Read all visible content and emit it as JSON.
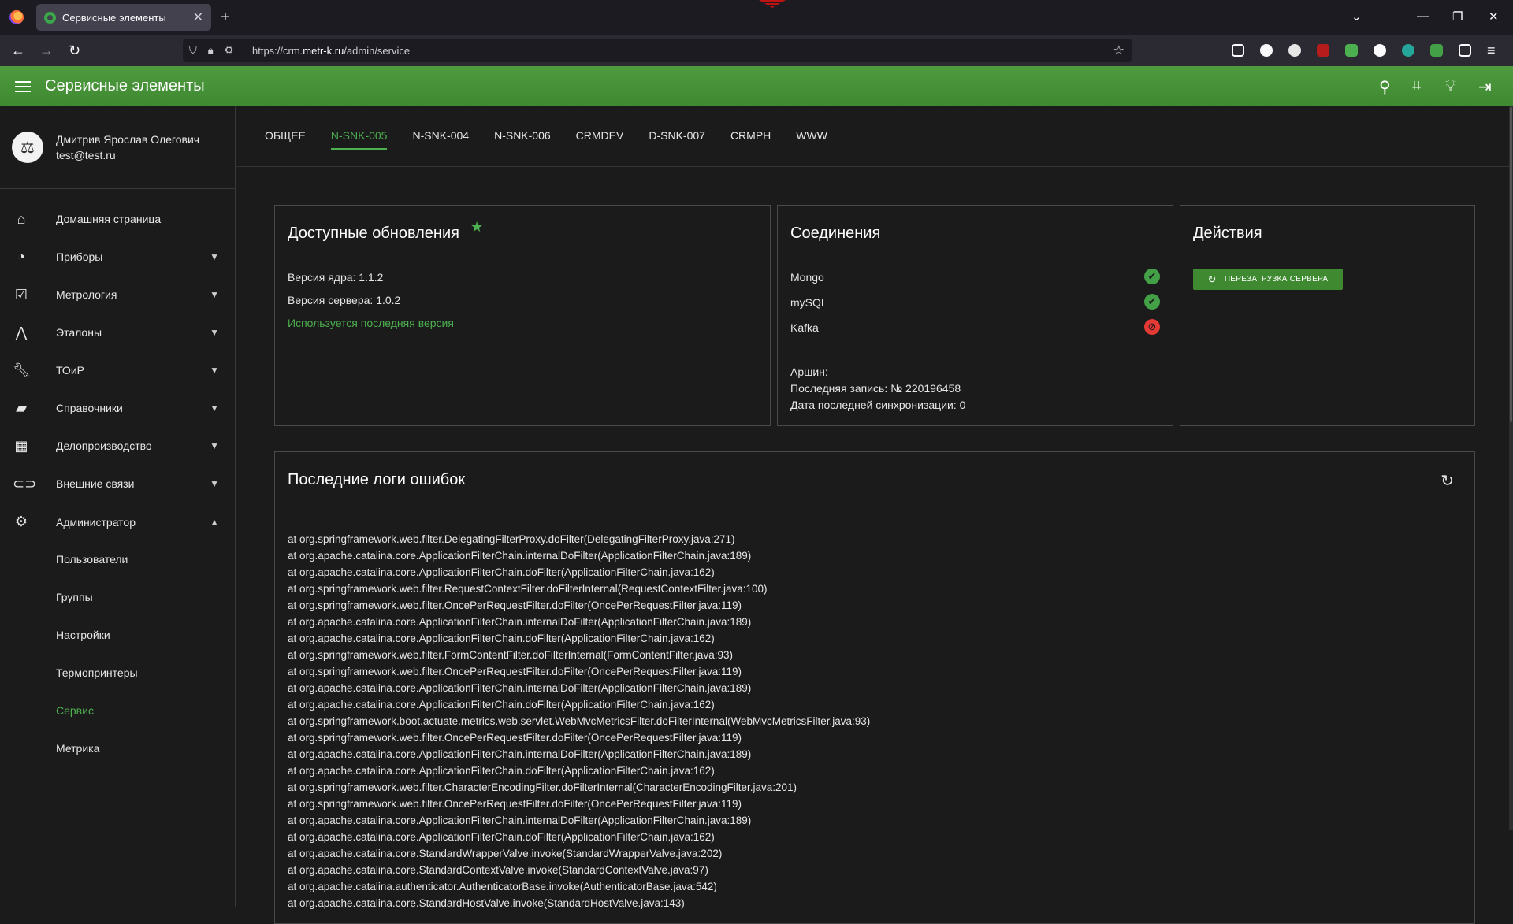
{
  "browser": {
    "tab_title": "Сервисные элементы",
    "tab_close": "✕",
    "new_tab": "+",
    "url_prefix": "https://crm.",
    "url_domain": "metr-k.ru",
    "url_path": "/admin/service"
  },
  "app": {
    "title": "Сервисные элементы"
  },
  "user": {
    "name": "Дмитрив Ярослав Олегович",
    "email": "test@test.ru"
  },
  "sidebar": {
    "items": [
      {
        "label": "Домашняя страница",
        "icon": "home-icon"
      },
      {
        "label": "Приборы",
        "icon": "gauge-icon"
      },
      {
        "label": "Метрология",
        "icon": "checkbox-icon"
      },
      {
        "label": "Эталоны",
        "icon": "compass-icon"
      },
      {
        "label": "ТОиР",
        "icon": "wrench-icon"
      },
      {
        "label": "Справочники",
        "icon": "folder-icon"
      },
      {
        "label": "Делопроизводство",
        "icon": "building-icon"
      },
      {
        "label": "Внешние связи",
        "icon": "link-icon"
      },
      {
        "label": "Администратор",
        "icon": "gear-icon"
      }
    ],
    "sub_items": [
      "Пользователи",
      "Группы",
      "Настройки",
      "Термопринтеры",
      "Сервис",
      "Метрика"
    ]
  },
  "tabs": [
    "ОБЩЕЕ",
    "N-SNK-005",
    "N-SNK-004",
    "N-SNK-006",
    "CRMDEV",
    "D-SNK-007",
    "CRMPH",
    "WWW"
  ],
  "updates": {
    "title": "Доступные обновления",
    "core_version": "Версия ядра: 1.1.2",
    "server_version": "Версия сервера: 1.0.2",
    "status": "Используется последняя версия"
  },
  "connections": {
    "title": "Соединения",
    "items": [
      {
        "name": "Mongo",
        "status": "ok"
      },
      {
        "name": "mySQL",
        "status": "ok"
      },
      {
        "name": "Kafka",
        "status": "error"
      }
    ],
    "arshin_label": "Аршин:",
    "last_record": "Последняя запись: № 220196458",
    "last_sync": "Дата последней синхронизации: 0"
  },
  "actions": {
    "title": "Действия",
    "restart_label": "ПЕРЕЗАГРУЗКА СЕРВЕРА"
  },
  "logs": {
    "title": "Последние логи ошибок",
    "lines": [
      "at org.springframework.web.filter.DelegatingFilterProxy.doFilter(DelegatingFilterProxy.java:271)",
      "at org.apache.catalina.core.ApplicationFilterChain.internalDoFilter(ApplicationFilterChain.java:189)",
      "at org.apache.catalina.core.ApplicationFilterChain.doFilter(ApplicationFilterChain.java:162)",
      "at org.springframework.web.filter.RequestContextFilter.doFilterInternal(RequestContextFilter.java:100)",
      "at org.springframework.web.filter.OncePerRequestFilter.doFilter(OncePerRequestFilter.java:119)",
      "at org.apache.catalina.core.ApplicationFilterChain.internalDoFilter(ApplicationFilterChain.java:189)",
      "at org.apache.catalina.core.ApplicationFilterChain.doFilter(ApplicationFilterChain.java:162)",
      "at org.springframework.web.filter.FormContentFilter.doFilterInternal(FormContentFilter.java:93)",
      "at org.springframework.web.filter.OncePerRequestFilter.doFilter(OncePerRequestFilter.java:119)",
      "at org.apache.catalina.core.ApplicationFilterChain.internalDoFilter(ApplicationFilterChain.java:189)",
      "at org.apache.catalina.core.ApplicationFilterChain.doFilter(ApplicationFilterChain.java:162)",
      "at org.springframework.boot.actuate.metrics.web.servlet.WebMvcMetricsFilter.doFilterInternal(WebMvcMetricsFilter.java:93)",
      "at org.springframework.web.filter.OncePerRequestFilter.doFilter(OncePerRequestFilter.java:119)",
      "at org.apache.catalina.core.ApplicationFilterChain.internalDoFilter(ApplicationFilterChain.java:189)",
      "at org.apache.catalina.core.ApplicationFilterChain.doFilter(ApplicationFilterChain.java:162)",
      "at org.springframework.web.filter.CharacterEncodingFilter.doFilterInternal(CharacterEncodingFilter.java:201)",
      "at org.springframework.web.filter.OncePerRequestFilter.doFilter(OncePerRequestFilter.java:119)",
      "at org.apache.catalina.core.ApplicationFilterChain.internalDoFilter(ApplicationFilterChain.java:189)",
      "at org.apache.catalina.core.ApplicationFilterChain.doFilter(ApplicationFilterChain.java:162)",
      "at org.apache.catalina.core.StandardWrapperValve.invoke(StandardWrapperValve.java:202)",
      "at org.apache.catalina.core.StandardContextValve.invoke(StandardContextValve.java:97)",
      "at org.apache.catalina.authenticator.AuthenticatorBase.invoke(AuthenticatorBase.java:542)",
      "at org.apache.catalina.core.StandardHostValve.invoke(StandardHostValve.java:143)"
    ]
  },
  "colors": {
    "accent": "#4caf50",
    "header": "#4a9a3c",
    "error": "#e53935"
  }
}
